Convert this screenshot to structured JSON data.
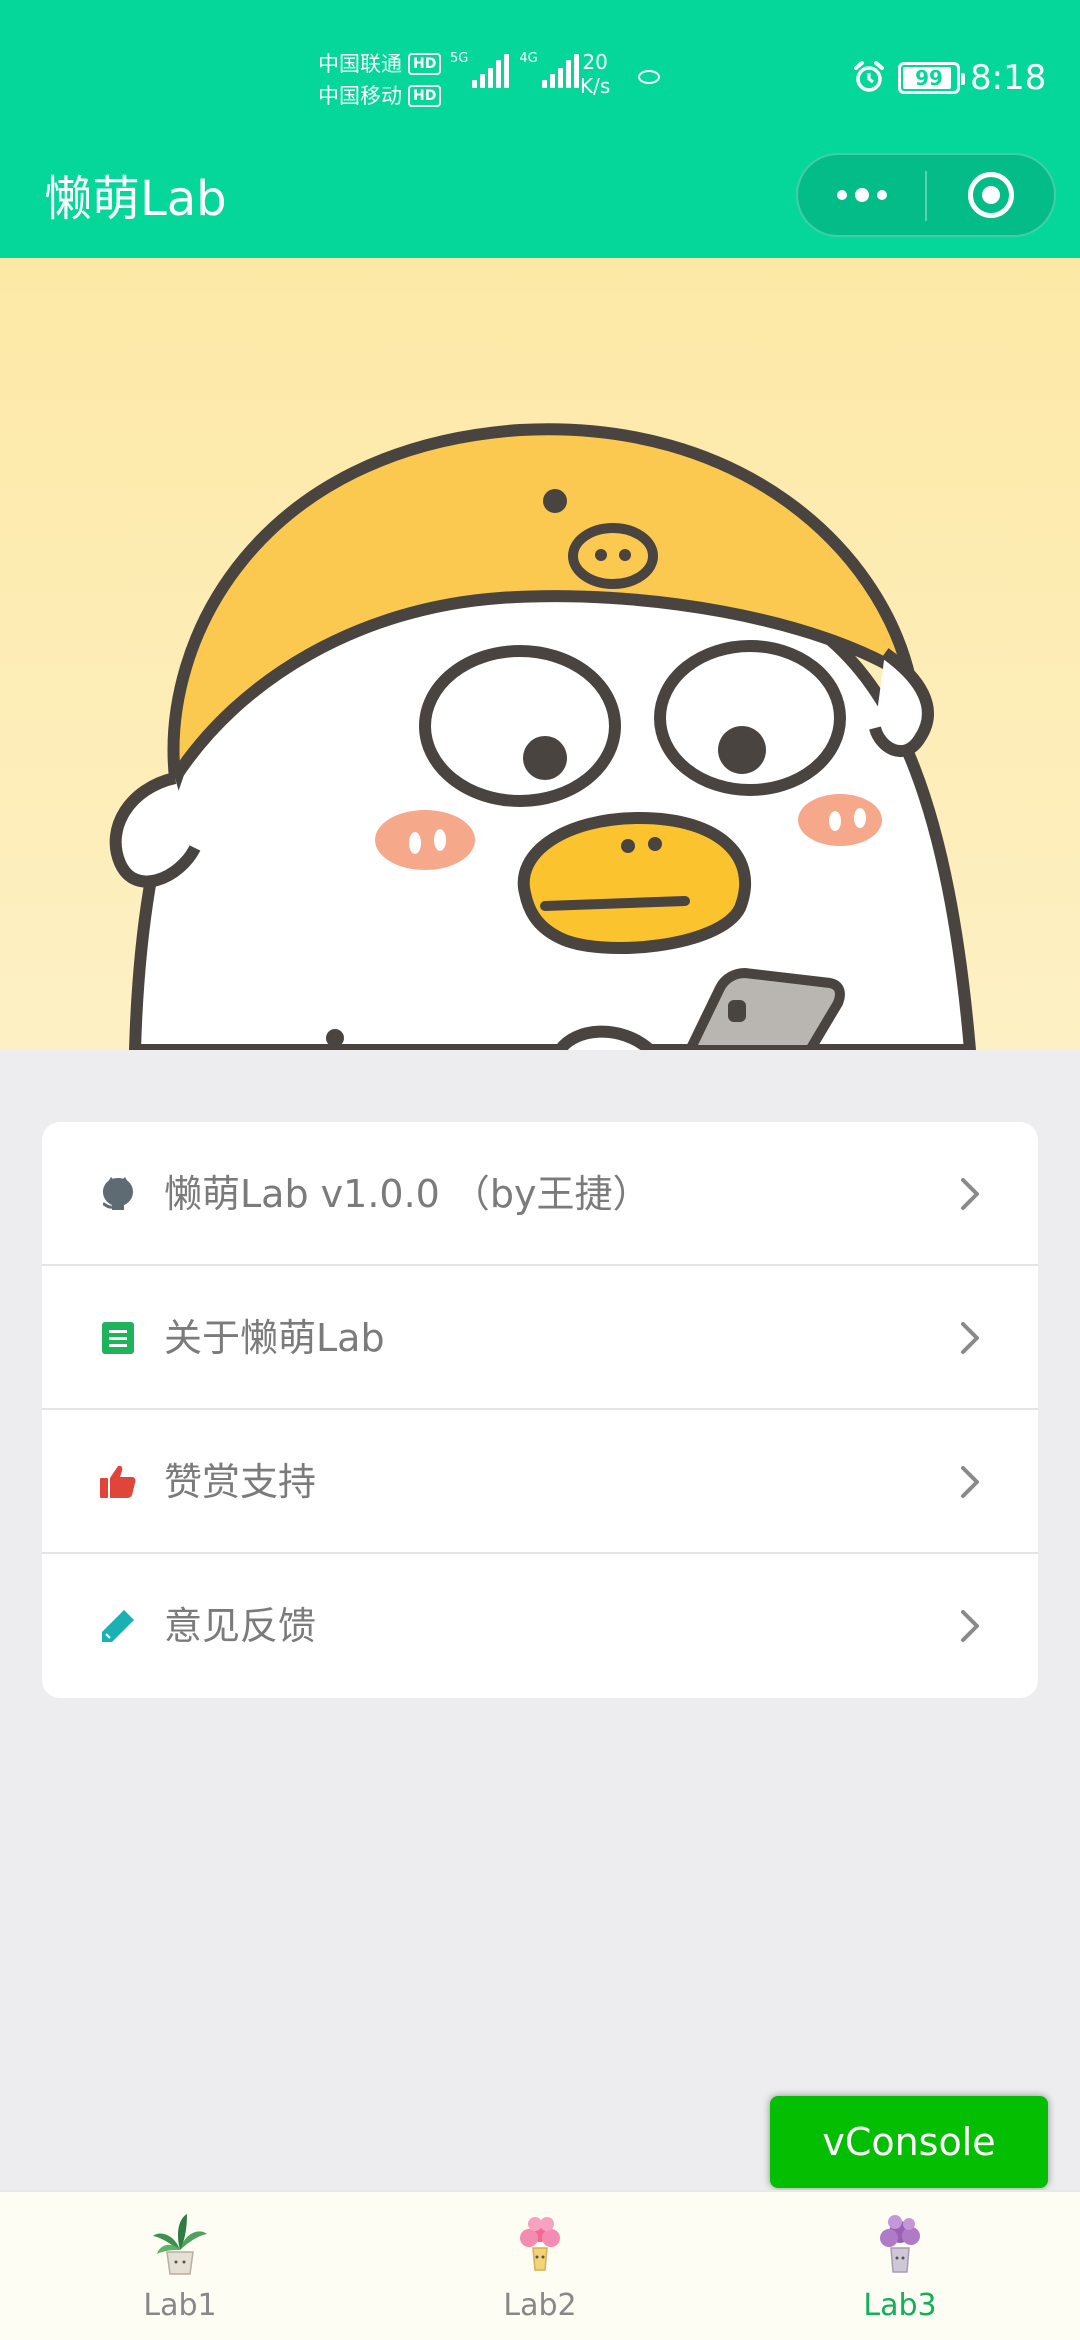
{
  "status_bar": {
    "carrier_1": "中国联通",
    "carrier_2": "中国移动",
    "hd_badge": "HD",
    "network_1": "5G",
    "network_2": "4G",
    "speed_value": "20",
    "speed_unit": "K/s",
    "battery_level": "99",
    "time": "8:18"
  },
  "nav_bar": {
    "title": "懒萌Lab",
    "more_icon": "more-dots-icon",
    "close_icon": "target-icon"
  },
  "banner": {
    "image": "duck-with-yellow-hat-illustration"
  },
  "menu": {
    "items": [
      {
        "icon": "github-icon",
        "label": "懒萌Lab v1.0.0 （by王捷）",
        "icon_color": "#5f6b73"
      },
      {
        "icon": "document-icon",
        "label": "关于懒萌Lab",
        "icon_color": "#1fb35b"
      },
      {
        "icon": "thumbs-up-icon",
        "label": "赞赏支持",
        "icon_color": "#e0453a"
      },
      {
        "icon": "pencil-icon",
        "label": "意见反馈",
        "icon_color": "#19b1b4"
      }
    ]
  },
  "vconsole": {
    "label": "vConsole"
  },
  "tab_bar": {
    "tabs": [
      {
        "label": "Lab1",
        "icon": "potted-plant-icon",
        "active": false
      },
      {
        "label": "Lab2",
        "icon": "pink-flower-pot-icon",
        "active": false
      },
      {
        "label": "Lab3",
        "icon": "purple-flower-pot-icon",
        "active": true
      }
    ],
    "active_color": "#13b05a",
    "inactive_color": "#888888"
  },
  "colors": {
    "primary": "#05d79b",
    "banner_bg": "#fdebb1",
    "page_bg": "#ededef"
  }
}
